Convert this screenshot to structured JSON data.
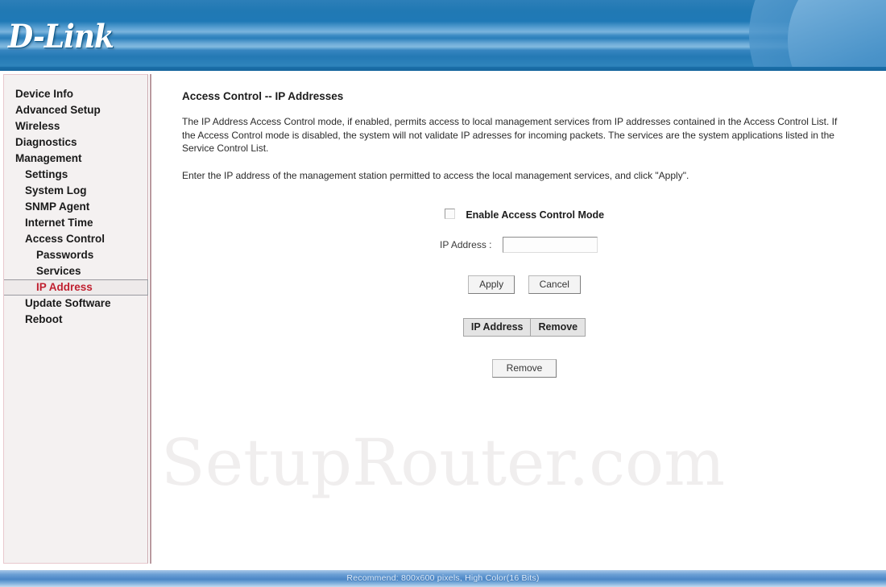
{
  "brand": {
    "logo_text": "D-Link"
  },
  "sidebar": {
    "items": [
      {
        "label": "Device Info",
        "level": 0,
        "selected": false
      },
      {
        "label": "Advanced Setup",
        "level": 0,
        "selected": false
      },
      {
        "label": "Wireless",
        "level": 0,
        "selected": false
      },
      {
        "label": "Diagnostics",
        "level": 0,
        "selected": false
      },
      {
        "label": "Management",
        "level": 0,
        "selected": false
      },
      {
        "label": "Settings",
        "level": 1,
        "selected": false
      },
      {
        "label": "System Log",
        "level": 1,
        "selected": false
      },
      {
        "label": "SNMP Agent",
        "level": 1,
        "selected": false
      },
      {
        "label": "Internet Time",
        "level": 1,
        "selected": false
      },
      {
        "label": "Access Control",
        "level": 1,
        "selected": false
      },
      {
        "label": "Passwords",
        "level": 2,
        "selected": false
      },
      {
        "label": "Services",
        "level": 2,
        "selected": false
      },
      {
        "label": "IP Address",
        "level": 2,
        "selected": true
      },
      {
        "label": "Update Software",
        "level": 1,
        "selected": false
      },
      {
        "label": "Reboot",
        "level": 1,
        "selected": false
      }
    ],
    "selected_color": "#c02030"
  },
  "main": {
    "title": "Access Control -- IP Addresses",
    "paragraph_1": "The IP Address Access Control mode, if enabled, permits access to local management services from IP addresses contained in the Access Control List. If the Access Control mode is disabled, the system will not validate IP adresses for incoming packets. The services are the system applications listed in the Service Control List.",
    "paragraph_2": "Enter the IP address of the management station permitted to access the local management services, and click \"Apply\".",
    "enable_checkbox": {
      "label": "Enable Access Control Mode",
      "checked": false
    },
    "ip_field": {
      "label": "IP Address :",
      "value": "",
      "placeholder": ""
    },
    "buttons": {
      "apply": "Apply",
      "cancel": "Cancel",
      "remove": "Remove"
    },
    "table": {
      "columns": [
        "IP Address",
        "Remove"
      ],
      "rows": []
    }
  },
  "watermark": {
    "text": "SetupRouter.com"
  },
  "footer": {
    "text": "Recommend: 800x600 pixels, High Color(16 Bits)",
    "background_color": "#4b86c6"
  }
}
